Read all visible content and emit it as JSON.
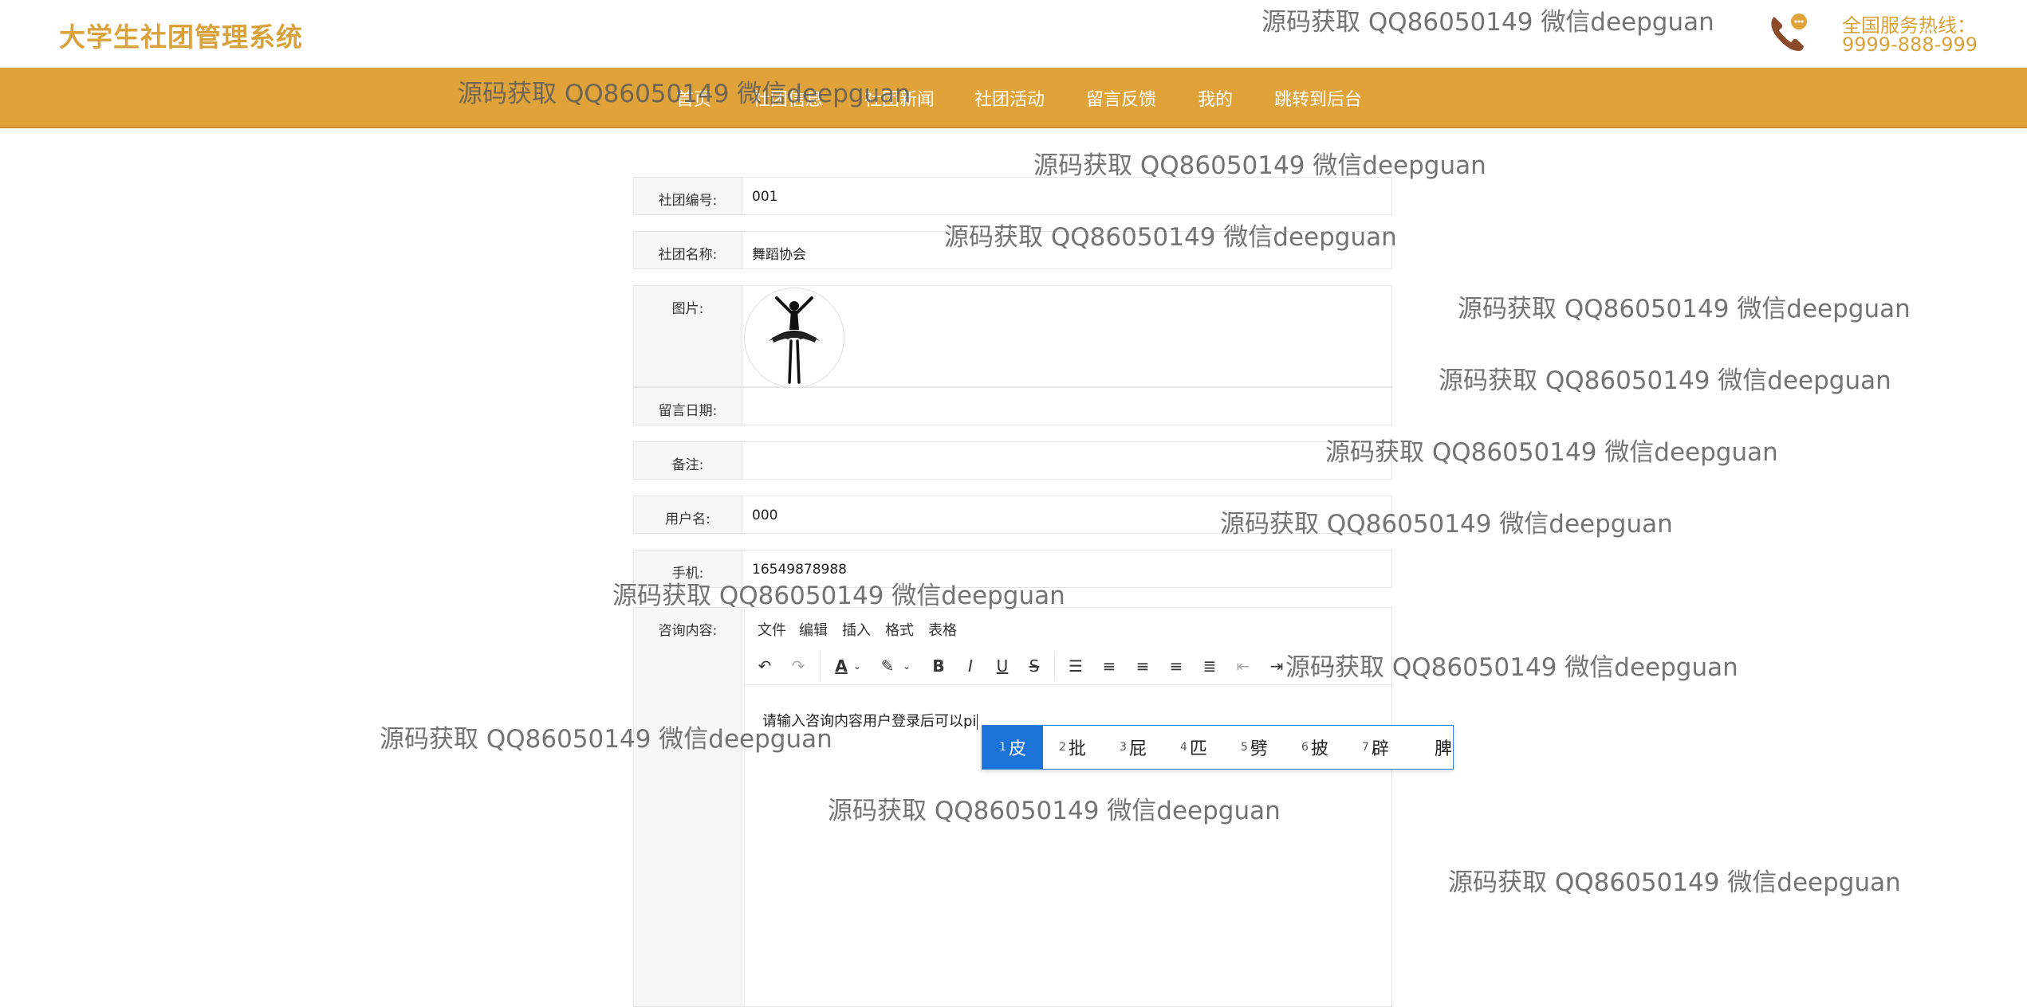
{
  "header": {
    "logo": "大学生社团管理系统",
    "hotline_label": "全国服务热线：",
    "hotline_number": "9999-888-999"
  },
  "nav": {
    "items": [
      "首页",
      "社团信息",
      "社团新闻",
      "社团活动",
      "留言反馈",
      "我的",
      "跳转到后台"
    ]
  },
  "form": {
    "fields": [
      {
        "label": "社团编号:",
        "value": "001"
      },
      {
        "label": "社团名称:",
        "value": "舞蹈协会"
      },
      {
        "label": "图片:",
        "value": ""
      },
      {
        "label": "留言日期:",
        "value": ""
      },
      {
        "label": "备注:",
        "value": ""
      },
      {
        "label": "用户名:",
        "value": "000"
      },
      {
        "label": "手机:",
        "value": "16549878988"
      },
      {
        "label": "咨询内容:",
        "value": ""
      }
    ],
    "editor": {
      "menu": [
        "文件",
        "编辑",
        "插入",
        "格式",
        "表格"
      ],
      "content": "请输入咨询内容用户登录后可以pi"
    }
  },
  "ime": {
    "candidates": [
      {
        "num": "1",
        "text": "皮"
      },
      {
        "num": "2",
        "text": "批"
      },
      {
        "num": "3",
        "text": "屁"
      },
      {
        "num": "4",
        "text": "匹"
      },
      {
        "num": "5",
        "text": "劈"
      },
      {
        "num": "6",
        "text": "披"
      },
      {
        "num": "7",
        "text": "辟"
      },
      {
        "num": "",
        "text": "脾"
      }
    ]
  },
  "watermark": "源码获取 QQ86050149 微信deepguan",
  "colors": {
    "brand": "#e0a33a",
    "logo": "#d9a23b",
    "ime_selected": "#1a73d9"
  }
}
